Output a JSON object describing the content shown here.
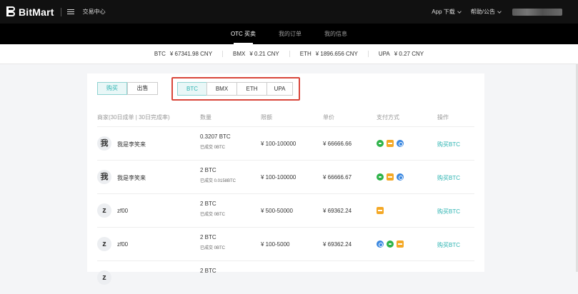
{
  "header": {
    "logo_text": "BitMart",
    "trade_center": "交易中心",
    "app_download": "App 下载",
    "help": "帮助/公告"
  },
  "subnav": {
    "tabs": [
      {
        "label": "OTC 买卖",
        "active": true
      },
      {
        "label": "我的订单",
        "active": false
      },
      {
        "label": "我的信息",
        "active": false
      }
    ]
  },
  "ticker": [
    {
      "symbol": "BTC",
      "price": "¥ 67341.98 CNY"
    },
    {
      "symbol": "BMX",
      "price": "¥ 0.21 CNY"
    },
    {
      "symbol": "ETH",
      "price": "¥ 1896.656 CNY"
    },
    {
      "symbol": "UPA",
      "price": "¥ 0.27 CNY"
    }
  ],
  "side": {
    "buy": "购买",
    "sell": "出售"
  },
  "coins": [
    "BTC",
    "BMX",
    "ETH",
    "UPA"
  ],
  "table": {
    "headers": {
      "merchant": "商家(30日成单 | 30日完成率)",
      "quantity": "数量",
      "limit": "限额",
      "price": "单价",
      "payment": "支付方式",
      "action": "操作"
    },
    "rows": [
      {
        "avatar": "我",
        "name": "我是李笑来",
        "qty": "0.3207 BTC",
        "done": "已成交 0BTC",
        "limit": "¥  100-100000",
        "price": "¥  66666.66",
        "pays": [
          "wechat-pay-icon",
          "bank-card-icon",
          "alipay-icon"
        ],
        "action": "购买BTC"
      },
      {
        "avatar": "我",
        "name": "我是李笑来",
        "qty": "2 BTC",
        "done": "已成交 0.0158BTC",
        "limit": "¥  100-100000",
        "price": "¥  66666.67",
        "pays": [
          "wechat-pay-icon",
          "bank-card-icon",
          "alipay-icon"
        ],
        "action": "购买BTC"
      },
      {
        "avatar": "z",
        "name": "zf00",
        "qty": "2 BTC",
        "done": "已成交 0BTC",
        "limit": "¥  500-50000",
        "price": "¥  69362.24",
        "pays": [
          "bank-card-icon"
        ],
        "action": "购买BTC"
      },
      {
        "avatar": "z",
        "name": "zf00",
        "qty": "2 BTC",
        "done": "已成交 0BTC",
        "limit": "¥  100-5000",
        "price": "¥  69362.24",
        "pays": [
          "alipay-icon",
          "wechat-pay-icon",
          "bank-card-icon"
        ],
        "action": "购买BTC"
      },
      {
        "avatar": "z",
        "name": "",
        "qty": "2 BTC",
        "done": "",
        "limit": "",
        "price": "",
        "pays": [],
        "action": ""
      }
    ]
  },
  "colors": {
    "accent": "#2bb3b1",
    "highlight_border": "#d9463a",
    "topbar": "#111111"
  }
}
